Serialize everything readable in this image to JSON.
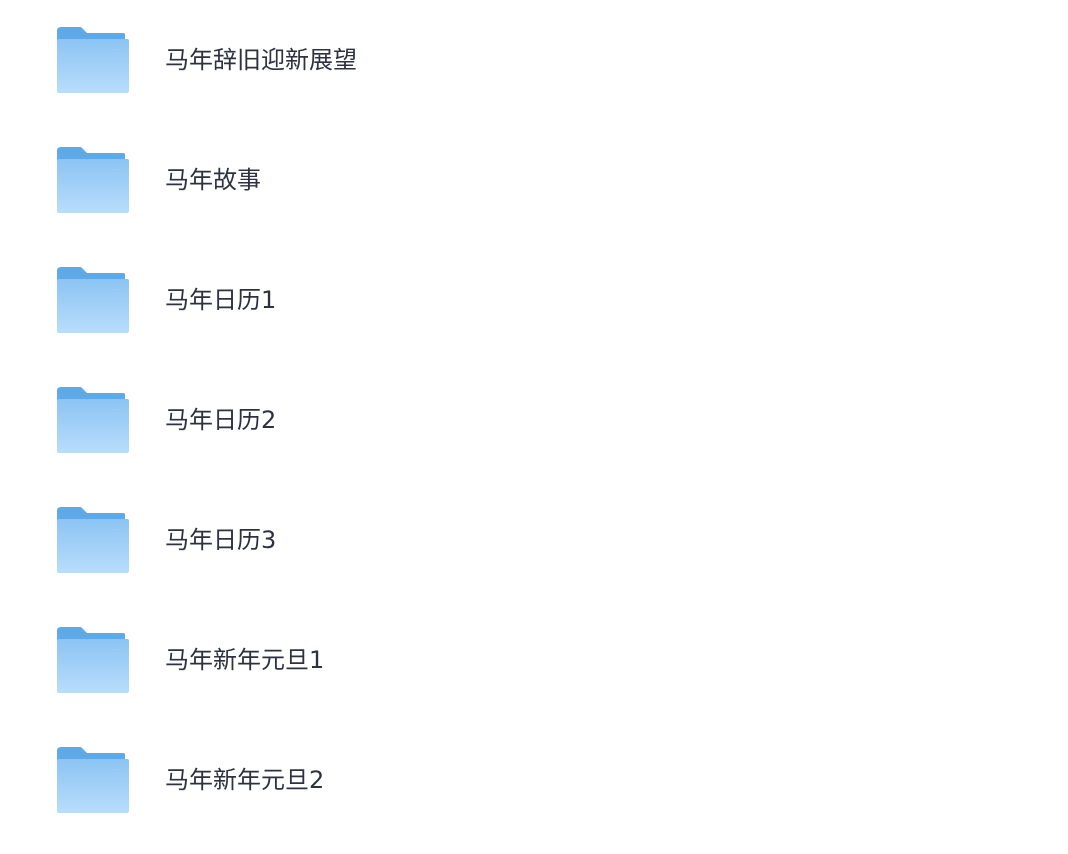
{
  "folders": [
    {
      "name": "马年辞旧迎新展望",
      "icon": "folder-icon"
    },
    {
      "name": "马年故事",
      "icon": "folder-icon"
    },
    {
      "name": "马年日历1",
      "icon": "folder-icon"
    },
    {
      "name": "马年日历2",
      "icon": "folder-icon"
    },
    {
      "name": "马年日历3",
      "icon": "folder-icon"
    },
    {
      "name": "马年新年元旦1",
      "icon": "folder-icon"
    },
    {
      "name": "马年新年元旦2",
      "icon": "folder-icon"
    }
  ],
  "colors": {
    "folder_back": "#5ea9e8",
    "folder_front_top": "#8cc4f3",
    "folder_front_bottom": "#b8ddfb",
    "text": "#2e3140"
  }
}
